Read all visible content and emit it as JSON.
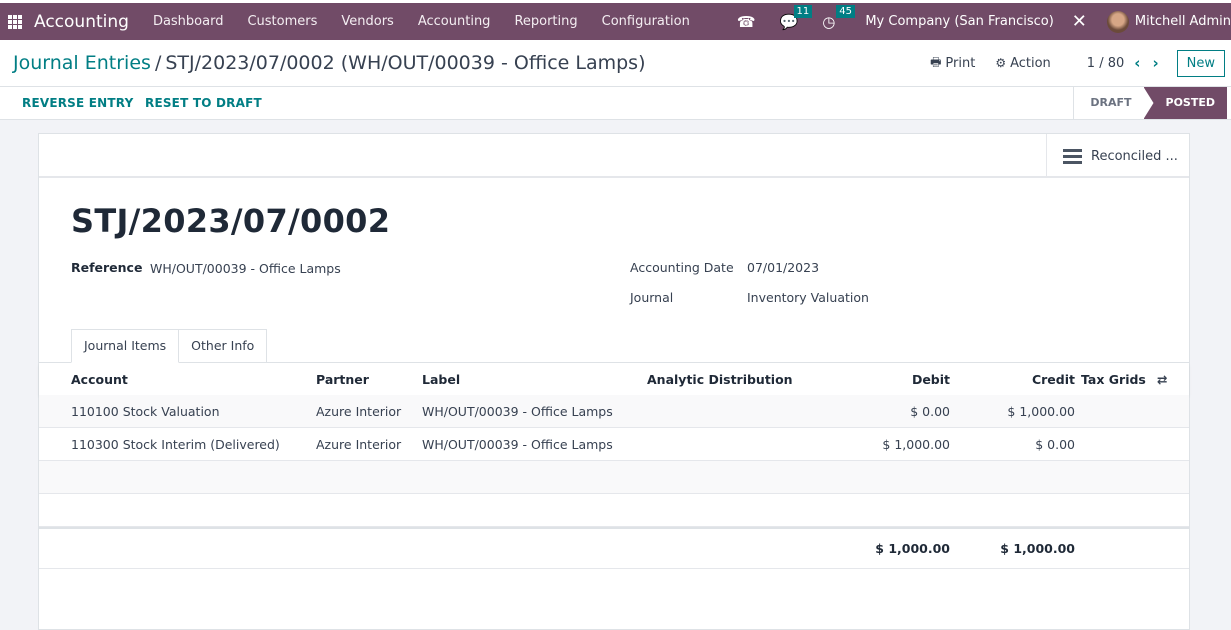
{
  "navbar": {
    "app_name": "Accounting",
    "menu": [
      "Dashboard",
      "Customers",
      "Vendors",
      "Accounting",
      "Reporting",
      "Configuration"
    ],
    "messages_count": "11",
    "activities_count": "45",
    "company": "My Company (San Francisco)",
    "user": "Mitchell Admin"
  },
  "control": {
    "breadcrumb_parent": "Journal Entries",
    "breadcrumb_separator": "/",
    "breadcrumb_current": "STJ/2023/07/0002 (WH/OUT/00039 - Office Lamps)",
    "print_label": "Print",
    "action_label": "Action",
    "pager": "1 / 80",
    "new_label": "New"
  },
  "statusbar": {
    "reverse_entry_label": "REVERSE ENTRY",
    "reset_to_draft_label": "RESET TO DRAFT",
    "states": [
      "DRAFT",
      "POSTED"
    ],
    "current_state": "POSTED"
  },
  "sheet": {
    "smart_button_label": "Reconciled ...",
    "title": "STJ/2023/07/0002",
    "reference_label": "Reference",
    "reference_value": "WH/OUT/00039 - Office Lamps",
    "accounting_date_label": "Accounting Date",
    "accounting_date_value": "07/01/2023",
    "journal_label": "Journal",
    "journal_value": "Inventory Valuation"
  },
  "tabs": [
    {
      "label": "Journal Items",
      "active": true
    },
    {
      "label": "Other Info",
      "active": false
    }
  ],
  "table": {
    "columns": [
      "Account",
      "Partner",
      "Label",
      "Analytic Distribution",
      "Debit",
      "Credit",
      "Tax Grids"
    ],
    "rows": [
      {
        "account": "110100 Stock Valuation",
        "partner": "Azure Interior",
        "label": "WH/OUT/00039 - Office Lamps",
        "analytic": "",
        "debit": "$ 0.00",
        "credit": "$ 1,000.00",
        "tax_grids": ""
      },
      {
        "account": "110300 Stock Interim (Delivered)",
        "partner": "Azure Interior",
        "label": "WH/OUT/00039 - Office Lamps",
        "analytic": "",
        "debit": "$ 1,000.00",
        "credit": "$ 0.00",
        "tax_grids": ""
      }
    ],
    "totals": {
      "debit": "$ 1,000.00",
      "credit": "$ 1,000.00"
    }
  },
  "colors": {
    "brand": "#714b67",
    "accent": "#017e84"
  }
}
